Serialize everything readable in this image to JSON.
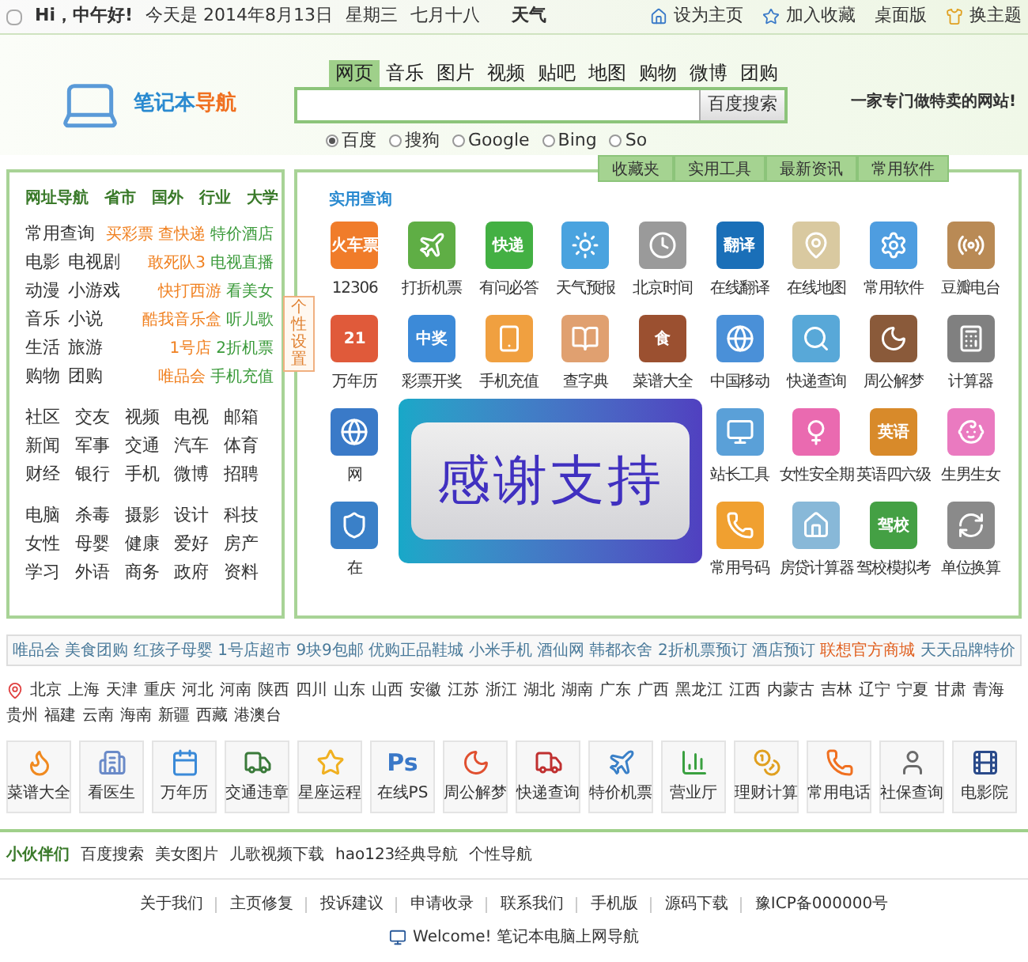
{
  "top_bar": {
    "greeting": "Hi，中午好!",
    "date": "今天是 2014年8月13日",
    "weekday": "星期三",
    "lunar": "七月十八",
    "weather": "天气",
    "links": [
      {
        "label": "设为主页"
      },
      {
        "label": "加入收藏"
      },
      {
        "label": "桌面版"
      },
      {
        "label": "换主题"
      }
    ]
  },
  "header": {
    "logo": {
      "part_1": "笔记本",
      "part_2": "导航"
    },
    "search_tabs": [
      {
        "label": "网页",
        "selected": true
      },
      {
        "label": "音乐",
        "selected": false
      },
      {
        "label": "图片",
        "selected": false
      },
      {
        "label": "视频",
        "selected": false
      },
      {
        "label": "贴吧",
        "selected": false
      },
      {
        "label": "地图",
        "selected": false
      },
      {
        "label": "购物",
        "selected": false
      },
      {
        "label": "微博",
        "selected": false
      },
      {
        "label": "团购",
        "selected": false
      }
    ],
    "search_button": "百度搜索",
    "slogan": "一家专门做特卖的网站!",
    "engines": [
      {
        "label": "百度",
        "selected": true
      },
      {
        "label": "搜狗",
        "selected": false
      },
      {
        "label": "Google",
        "selected": false
      },
      {
        "label": "Bing",
        "selected": false
      },
      {
        "label": "So",
        "selected": false
      }
    ]
  },
  "left_panel": {
    "categories": [
      "网址导航",
      "省市",
      "国外",
      "行业",
      "大学"
    ],
    "featured_rows": [
      {
        "items": [
          "常用查询"
        ],
        "promos": [
          {
            "label": "买彩票",
            "color": "#f08020"
          },
          {
            "label": "查快递",
            "color": "#f08020"
          },
          {
            "label": "特价酒店",
            "color": "#3a9a3a"
          }
        ]
      },
      {
        "items": [
          "电影",
          "电视剧"
        ],
        "promos": [
          {
            "label": "敢死队3",
            "color": "#f08020"
          },
          {
            "label": "电视直播",
            "color": "#3a9a3a"
          }
        ]
      },
      {
        "items": [
          "动漫",
          "小游戏"
        ],
        "promos": [
          {
            "label": "快打西游",
            "color": "#f08020"
          },
          {
            "label": "看美女",
            "color": "#3a9a3a"
          }
        ]
      },
      {
        "items": [
          "音乐",
          "小说"
        ],
        "promos": [
          {
            "label": "酷我音乐盒",
            "color": "#f08020"
          },
          {
            "label": "听儿歌",
            "color": "#3a9a3a"
          }
        ]
      },
      {
        "items": [
          "生活",
          "旅游"
        ],
        "promos": [
          {
            "label": "1号店",
            "color": "#f08020"
          },
          {
            "label": "2折机票",
            "color": "#3a9a3a"
          }
        ]
      },
      {
        "items": [
          "购物",
          "团购"
        ],
        "promos": [
          {
            "label": "唯品会",
            "color": "#f08020"
          },
          {
            "label": "手机充值",
            "color": "#3a9a3a"
          }
        ]
      }
    ],
    "sections": [
      [
        [
          "社区",
          "交友",
          "视频",
          "电视",
          "邮箱"
        ],
        [
          "新闻",
          "军事",
          "交通",
          "汽车",
          "体育"
        ],
        [
          "财经",
          "银行",
          "手机",
          "微博",
          "招聘"
        ]
      ],
      [
        [
          "电脑",
          "杀毒",
          "摄影",
          "设计",
          "科技"
        ],
        [
          "女性",
          "母婴",
          "健康",
          "爱好",
          "房产"
        ],
        [
          "学习",
          "外语",
          "商务",
          "政府",
          "资料"
        ]
      ]
    ]
  },
  "side_tab": "个性设置",
  "right_panel": {
    "tabs": [
      {
        "label": "收藏夹"
      },
      {
        "label": "实用工具"
      },
      {
        "label": "最新资讯"
      },
      {
        "label": "常用软件"
      }
    ],
    "section_title": "实用查询",
    "tools": [
      {
        "kind": "tool",
        "label": "12306",
        "icon_text": "火车票"
      },
      {
        "kind": "tool",
        "label": "打折机票"
      },
      {
        "kind": "tool",
        "label": "有问必答",
        "icon_text": "快递"
      },
      {
        "kind": "tool",
        "label": "天气预报"
      },
      {
        "kind": "tool",
        "label": "北京时间"
      },
      {
        "kind": "tool",
        "label": "在线翻译",
        "icon_text": "翻译"
      },
      {
        "kind": "tool",
        "label": "在线地图"
      },
      {
        "kind": "tool",
        "label": "常用软件"
      },
      {
        "kind": "tool",
        "label": "豆瓣电台"
      },
      {
        "kind": "tool",
        "label": "万年历",
        "icon_text": "21"
      },
      {
        "kind": "tool",
        "label": "彩票开奖",
        "icon_text": "中奖"
      },
      {
        "kind": "tool",
        "label": "手机充值"
      },
      {
        "kind": "tool",
        "label": "查字典"
      },
      {
        "kind": "tool",
        "label": "菜谱大全",
        "icon_text": "食"
      },
      {
        "kind": "tool",
        "label": "中国移动"
      },
      {
        "kind": "tool",
        "label": "快递查询"
      },
      {
        "kind": "tool",
        "label": "周公解梦"
      },
      {
        "kind": "tool",
        "label": "计算器"
      },
      {
        "kind": "tool",
        "label": "网"
      },
      {
        "kind": "covered"
      },
      {
        "kind": "covered"
      },
      {
        "kind": "covered"
      },
      {
        "kind": "covered"
      },
      {
        "kind": "tool",
        "label": "站长工具"
      },
      {
        "kind": "tool",
        "label": "女性安全期"
      },
      {
        "kind": "tool",
        "label": "英语四六级",
        "icon_text": "英语"
      },
      {
        "kind": "tool",
        "label": "生男生女"
      },
      {
        "kind": "tool",
        "label": "在"
      },
      {
        "kind": "covered"
      },
      {
        "kind": "covered"
      },
      {
        "kind": "covered"
      },
      {
        "kind": "covered"
      },
      {
        "kind": "tool",
        "label": "常用号码"
      },
      {
        "kind": "tool",
        "label": "房贷计算器"
      },
      {
        "kind": "tool",
        "label": "驾校模拟考",
        "icon_text": "驾校"
      },
      {
        "kind": "tool",
        "label": "单位换算"
      }
    ]
  },
  "overlay": {
    "text": "感谢支持"
  },
  "shop_links": [
    {
      "label": "唯品会",
      "highlighted": false
    },
    {
      "label": "美食团购",
      "highlighted": false
    },
    {
      "label": "红孩子母婴",
      "highlighted": false
    },
    {
      "label": "1号店超市",
      "highlighted": false
    },
    {
      "label": "9块9包邮",
      "highlighted": false
    },
    {
      "label": "优购正品鞋城",
      "highlighted": false
    },
    {
      "label": "小米手机",
      "highlighted": false
    },
    {
      "label": "酒仙网",
      "highlighted": false
    },
    {
      "label": "韩都衣舍",
      "highlighted": false
    },
    {
      "label": "2折机票预订",
      "highlighted": false
    },
    {
      "label": "酒店预订",
      "highlighted": false
    },
    {
      "label": "联想官方商城",
      "highlighted": true
    },
    {
      "label": "天天品牌特价",
      "highlighted": false
    }
  ],
  "provinces": [
    "北京",
    "上海",
    "天津",
    "重庆",
    "河北",
    "河南",
    "陕西",
    "四川",
    "山东",
    "山西",
    "安徽",
    "江苏",
    "浙江",
    "湖北",
    "湖南",
    "广东",
    "广西",
    "黑龙江",
    "江西",
    "内蒙古",
    "吉林",
    "辽宁",
    "宁夏",
    "甘肃",
    "青海",
    "贵州",
    "福建",
    "云南",
    "海南",
    "新疆",
    "西藏",
    "港澳台"
  ],
  "quick_tiles": [
    {
      "label": "菜谱大全"
    },
    {
      "label": "看医生"
    },
    {
      "label": "万年历"
    },
    {
      "label": "交通违章"
    },
    {
      "label": "星座运程"
    },
    {
      "label": "在线PS",
      "icon_text": "Ps"
    },
    {
      "label": "周公解梦"
    },
    {
      "label": "快递查询"
    },
    {
      "label": "特价机票"
    },
    {
      "label": "营业厅"
    },
    {
      "label": "理财计算"
    },
    {
      "label": "常用电话"
    },
    {
      "label": "社保查询"
    },
    {
      "label": "电影院"
    }
  ],
  "partners": {
    "title": "小伙伴们",
    "links": [
      "百度搜索",
      "美女图片",
      "儿歌视频下载",
      "hao123经典导航",
      "个性导航"
    ]
  },
  "footer": {
    "links": [
      "关于我们",
      "主页修复",
      "投诉建议",
      "申请收录",
      "联系我们",
      "手机版",
      "源码下载",
      "豫ICP备000000号"
    ],
    "welcome": "Welcome! 笔记本电脑上网导航"
  }
}
